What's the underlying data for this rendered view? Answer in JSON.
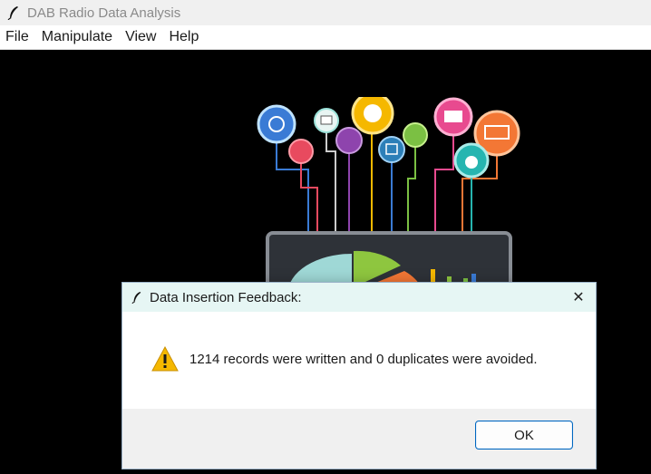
{
  "window": {
    "title": "DAB Radio Data Analysis"
  },
  "menu": [
    "File",
    "Manipulate",
    "View",
    "Help"
  ],
  "dialog": {
    "title": "Data Insertion Feedback:",
    "message": "1214 records were written and 0 duplicates were avoided.",
    "ok_label": "OK",
    "close_glyph": "✕"
  },
  "colors": {
    "background": "#000000",
    "dialog_titlebar": "#e6f6f4",
    "ok_border": "#0067c0",
    "warning": "#f5b800"
  }
}
